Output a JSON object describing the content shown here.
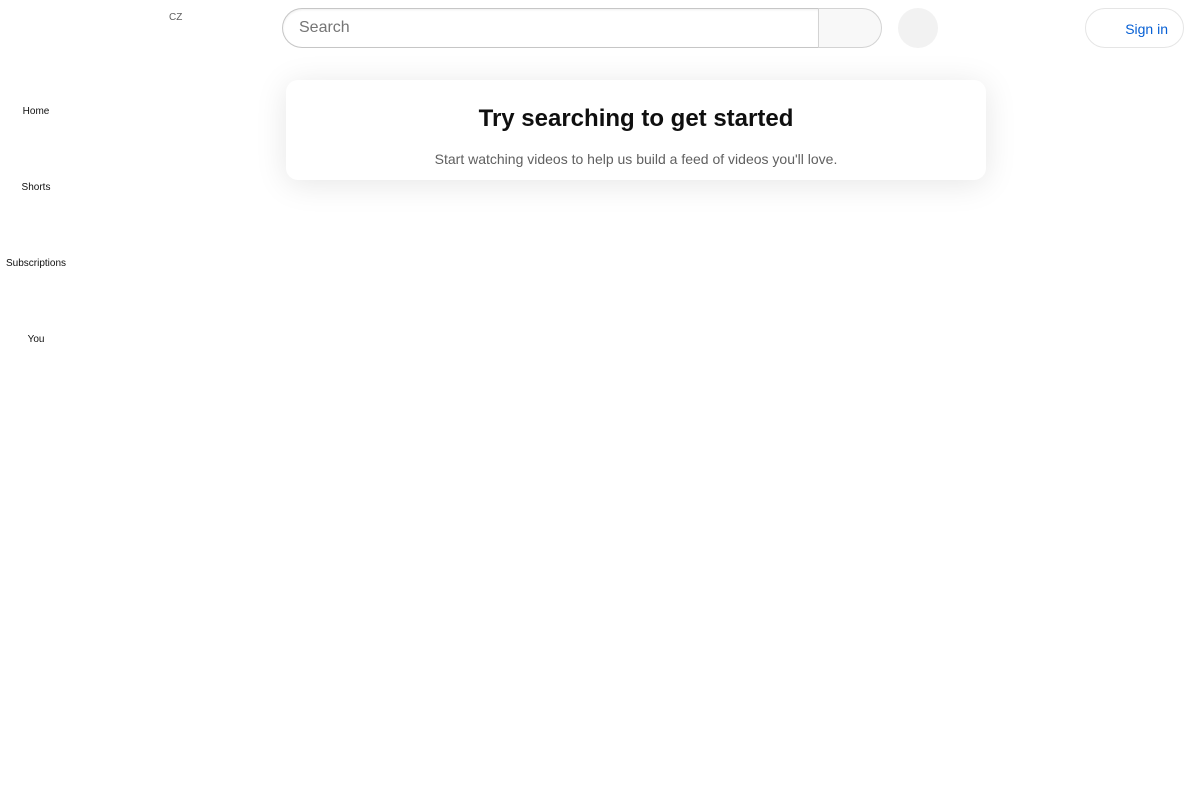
{
  "masthead": {
    "country_code": "CZ",
    "search": {
      "placeholder": "Search",
      "value": ""
    },
    "signin_label": "Sign in",
    "icons": {
      "menu": "menu-icon",
      "logo": "youtube-logo",
      "search": "search-icon",
      "mic": "microphone-icon",
      "settings": "more-vertical-icon",
      "account": "account-circle-icon"
    },
    "colors": {
      "signin_text": "#065fd4",
      "signin_border": "#e5e5e5"
    }
  },
  "sidebar": {
    "items": [
      {
        "label": "Home",
        "icon": "home-icon"
      },
      {
        "label": "Shorts",
        "icon": "shorts-icon"
      },
      {
        "label": "Subscriptions",
        "icon": "subscriptions-icon"
      },
      {
        "label": "You",
        "icon": "you-icon"
      }
    ]
  },
  "main": {
    "prompt": {
      "title": "Try searching to get started",
      "subtitle": "Start watching videos to help us build a feed of videos you'll love."
    }
  }
}
